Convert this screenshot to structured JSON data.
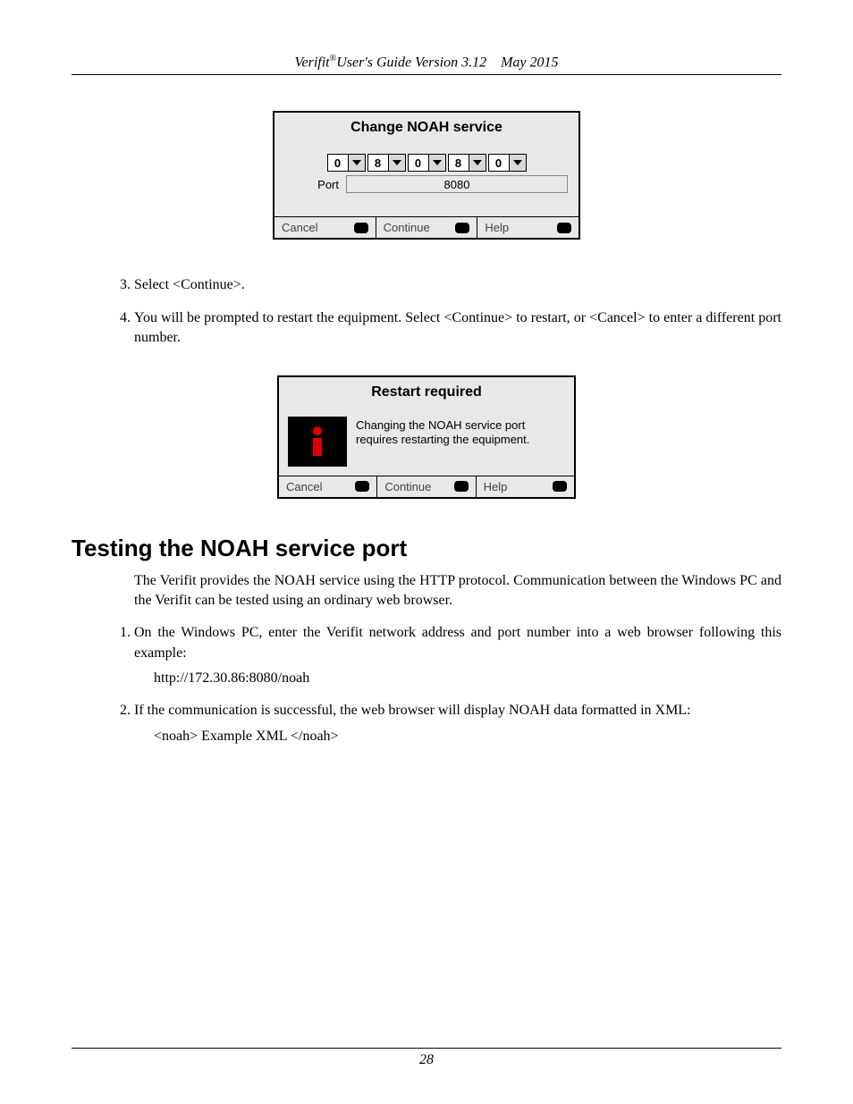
{
  "header": {
    "product": "Verifit",
    "reg": "®",
    "title_rest": "User's Guide Version 3.12",
    "date": "May 2015"
  },
  "dialog1": {
    "title": "Change NOAH service",
    "digits": [
      "0",
      "8",
      "0",
      "8",
      "0"
    ],
    "port_label": "Port",
    "port_value": "8080",
    "buttons": {
      "cancel": "Cancel",
      "continue": "Continue",
      "help": "Help"
    }
  },
  "steps_a": {
    "s3": "Select <Continue>.",
    "s4": "You will be prompted to restart the equipment.  Select <Continue> to restart, or <Cancel> to enter a different port number."
  },
  "dialog2": {
    "title": "Restart required",
    "message": "Changing the NOAH service port requires restarting the equipment.",
    "buttons": {
      "cancel": "Cancel",
      "continue": "Continue",
      "help": "Help"
    }
  },
  "section": {
    "heading": "Testing the NOAH service port",
    "intro": "The Verifit provides the NOAH service using the HTTP protocol.  Communication between the Windows PC and the Verifit can be tested using an ordinary web browser."
  },
  "steps_b": {
    "s1": "On the Windows PC, enter the Verifit network address and port number into a web browser following this example:",
    "s1_example": "http://172.30.86:8080/noah",
    "s2": "If the communication is successful, the web browser will display NOAH data formatted in XML:",
    "s2_example": "<noah> Example XML </noah>"
  },
  "footer": {
    "page_number": "28"
  }
}
